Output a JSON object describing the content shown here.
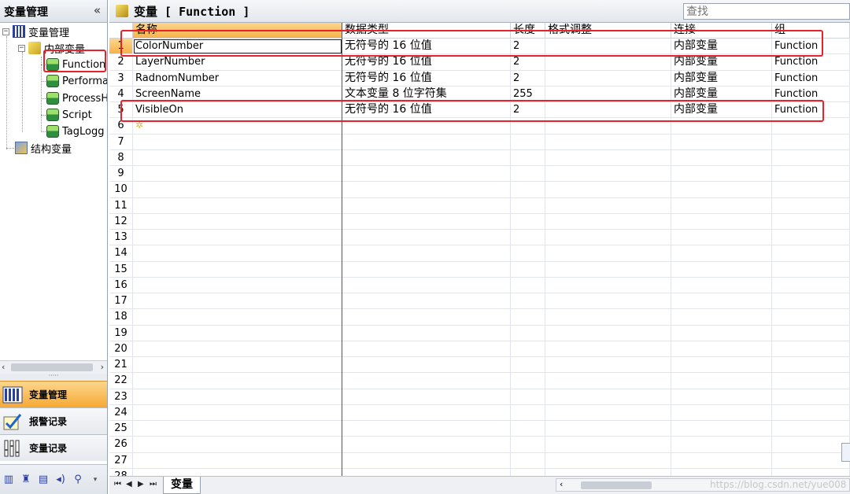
{
  "left_panel": {
    "title": "变量管理",
    "collapse_icon": "«",
    "tree": {
      "root": "变量管理",
      "internal": "内部变量",
      "groups": [
        "Function",
        "Performa",
        "ProcessH",
        "Script",
        "TagLogg"
      ],
      "struct": "结构变量"
    },
    "nav_buttons": [
      {
        "label": "变量管理",
        "icon": "variable-table-icon",
        "active": true
      },
      {
        "label": "报警记录",
        "icon": "alarm-log-icon",
        "active": false
      },
      {
        "label": "变量记录",
        "icon": "tag-log-icon",
        "active": false
      }
    ],
    "toolbar_icons": [
      "table-icon",
      "user-icon",
      "text-icon",
      "audio-icon",
      "cross-reference-icon",
      "dropdown-icon"
    ]
  },
  "right_panel": {
    "title": "变量 [ Function ]",
    "search_placeholder": "查找",
    "columns": [
      "名称",
      "数据类型",
      "长度",
      "格式调整",
      "连接",
      "组"
    ],
    "rows": [
      {
        "num": "1",
        "name": "ColorNumber",
        "type": "无符号的 16 位值",
        "length": "2",
        "format": "",
        "connection": "内部变量",
        "group": "Function"
      },
      {
        "num": "2",
        "name": "LayerNumber",
        "type": "无符号的 16 位值",
        "length": "2",
        "format": "",
        "connection": "内部变量",
        "group": "Function"
      },
      {
        "num": "3",
        "name": "RadnomNumber",
        "type": "无符号的 16 位值",
        "length": "2",
        "format": "",
        "connection": "内部变量",
        "group": "Function"
      },
      {
        "num": "4",
        "name": "ScreenName",
        "type": "文本变量 8 位字符集",
        "length": "255",
        "format": "",
        "connection": "内部变量",
        "group": "Function"
      },
      {
        "num": "5",
        "name": "VisibleOn",
        "type": "无符号的 16 位值",
        "length": "2",
        "format": "",
        "connection": "内部变量",
        "group": "Function"
      }
    ],
    "empty_row_numbers": [
      "6",
      "7",
      "8",
      "9",
      "10",
      "11",
      "12",
      "13",
      "14",
      "15",
      "16",
      "17",
      "18",
      "19",
      "20",
      "21",
      "22",
      "23",
      "24",
      "25",
      "26",
      "27",
      "28"
    ],
    "new_row_icon": "✲",
    "sheet_tab": "变量",
    "pager": [
      "⏮",
      "◀",
      "▶",
      "⏭"
    ],
    "watermark": "https://blog.csdn.net/yue008"
  },
  "colors": {
    "highlight_red": "#e8222a",
    "active_orange": "#f6b24a"
  }
}
